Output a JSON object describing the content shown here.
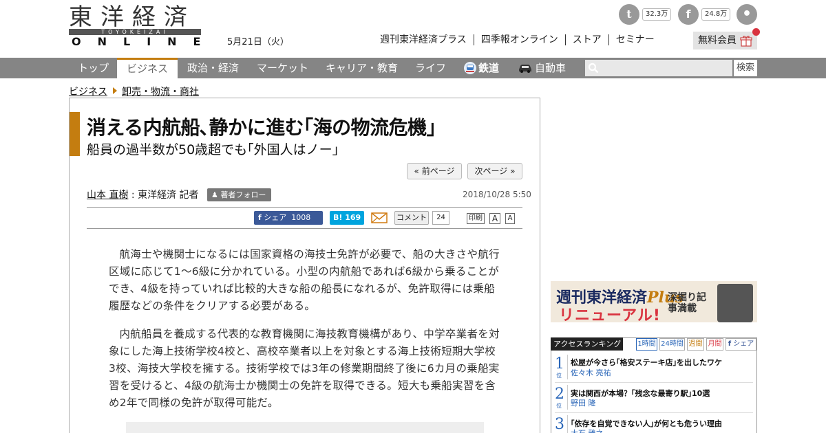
{
  "header": {
    "logo_jp": "東洋経済",
    "logo_sub": "TOYOKEIZAI",
    "logo_en": "ONLINE",
    "date": "5月21日（火）",
    "links": [
      "週刊東洋経済プラス",
      "四季報オンライン",
      "ストア",
      "セミナー"
    ],
    "member_label": "無料会員",
    "twitter_count": "32.3万",
    "facebook_count": "24.8万",
    "twitter_glyph": "t",
    "facebook_glyph": "f",
    "rss_glyph": "•"
  },
  "nav": {
    "items": [
      "トップ",
      "ビジネス",
      "政治・経済",
      "マーケット",
      "キャリア・教育",
      "ライフ",
      "鉄道",
      "自動車"
    ],
    "active_index": 1,
    "search_button": "検索"
  },
  "breadcrumb": [
    "ビジネス",
    "卸売・物流・商社"
  ],
  "article": {
    "title": "消える内航船､静かに進む｢海の物流危機｣",
    "subtitle": "船員の過半数が50歳超でも｢外国人はノー｣",
    "prev_page": "« 前ページ",
    "next_page": "次ページ »",
    "author_name": "山本 直樹",
    "author_role": " : 東洋経済 記者",
    "follow_label": "著者フォロー",
    "published": "2018/10/28 5:50",
    "fb_share_label": "シェア",
    "fb_share_count": "1008",
    "hatena_label": "B!",
    "hatena_count": "169",
    "comment_label": "コメント",
    "comment_count": "24",
    "print_label": "印刷",
    "font_large": "A",
    "font_small": "A",
    "paragraphs": [
      "航海士や機関士になるには国家資格の海技士免許が必要で、船の大きさや航行区域に応じて1～6級に分かれている。小型の内航船であれば6級から乗ることができ、4級を持っていれば比較的大きな船の船長になれるが、免許取得には乗船履歴などの条件をクリアする必要がある。",
      "内航船員を養成する代表的な教育機関に海技教育機構があり、中学卒業者を対象にした海上技術学校4校と、高校卒業者以上を対象とする海上技術短期大学校3校、海技大学校を擁する。技術学校では3年の修業期間終了後に6カ月の乗船実習を受けると、4級の航海士か機関士の免許を取得できる。短大も乗船実習を含め2年で同様の免許が取得可能だ。"
    ]
  },
  "sidebar": {
    "banner": {
      "brand": "週刊東洋経済",
      "plus": "Plus",
      "renewal": "リニューアル!",
      "tagline": "深掘り記事満載"
    },
    "ranking": {
      "heading": "アクセスランキング",
      "tabs": [
        "1時間",
        "24時間",
        "週間",
        "月間",
        "シェア"
      ],
      "active_tab": 0,
      "rank_suffix": "位",
      "items": [
        {
          "rank": "1",
          "title": "松屋が今さら｢格安ステーキ店｣を出したワケ",
          "author": "佐々木 亮祐"
        },
        {
          "rank": "2",
          "title": "実は関西が本場？｢残念な最寄り駅｣10選",
          "author": "野田 隆"
        },
        {
          "rank": "3",
          "title": "｢依存を自覚できない人｣が何とも危うい理由",
          "author": "大石 雅之"
        }
      ]
    }
  },
  "colors": {
    "accent": "#c47d10",
    "nav_bg": "#858585",
    "facebook": "#3b5998",
    "hatena": "#00a4de",
    "rank_blue": "#2a66b8",
    "badge_red": "#d9333f"
  }
}
